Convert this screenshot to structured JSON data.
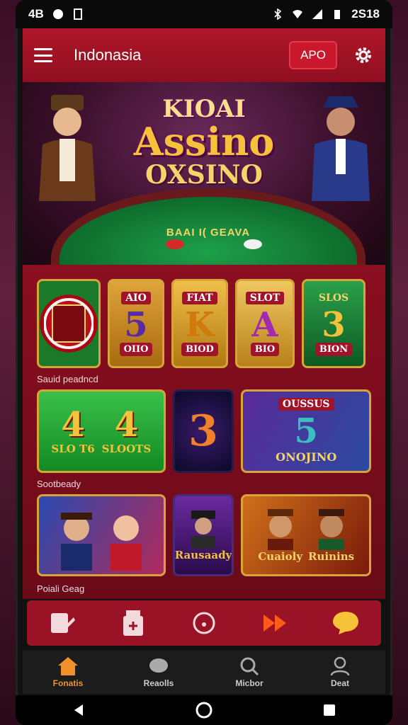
{
  "status_bar": {
    "left_text": "4B",
    "time": "2S18"
  },
  "header": {
    "title": "Indonasia",
    "app_button": "APO"
  },
  "hero": {
    "logo_top": "KIOAI",
    "logo_main": "Assino",
    "logo_bottom": "OXSINO",
    "table_text": "BAAI I( GEAVA"
  },
  "row1": [
    {
      "top": "",
      "big": "",
      "cap": ""
    },
    {
      "top": "AIO",
      "big": "5",
      "cap": "OIIO"
    },
    {
      "top": "FIAT",
      "big": "K",
      "cap": "BIOD"
    },
    {
      "top": "SLOT",
      "big": "A",
      "cap": "BIO"
    },
    {
      "top": "SLOS",
      "big": "3",
      "cap": "BION"
    }
  ],
  "section1_label": "Sauid peadncd",
  "row2": [
    {
      "big": "4",
      "cap": "SLO T6"
    },
    {
      "big": "4",
      "cap": "SLOOTS"
    },
    {
      "big": "3",
      "cap": ""
    },
    {
      "top": "OUSSUS",
      "big": "5",
      "cap": "ONOJINO"
    }
  ],
  "section2_label": "Sootbeady",
  "row3": [
    {
      "cap": ""
    },
    {
      "cap": "Rausaady"
    },
    {
      "cap": "Cuaioly"
    },
    {
      "cap": "Ruinins"
    }
  ],
  "section3_label": "Poiali Geag",
  "bottom_nav": [
    {
      "label": "Fonatis"
    },
    {
      "label": "Reaolls"
    },
    {
      "label": "Micbor"
    },
    {
      "label": "Deat"
    }
  ],
  "colors": {
    "brand_red": "#9a1226",
    "gold": "#d7a43a",
    "active_orange": "#f0902a"
  }
}
